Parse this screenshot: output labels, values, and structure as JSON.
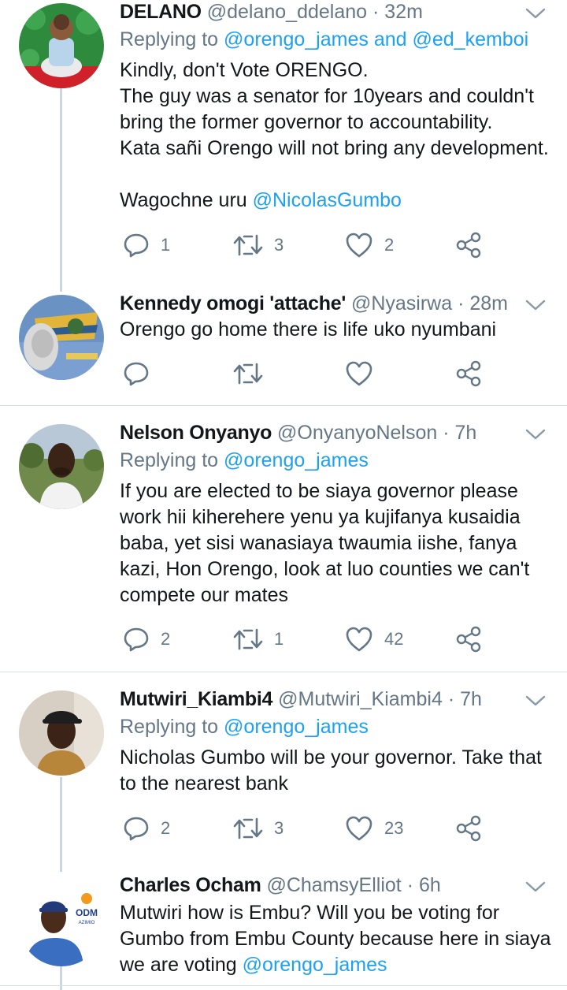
{
  "tweets": [
    {
      "name": "DELANO",
      "handle": "@delano_ddelano",
      "dot": "·",
      "time": "32m",
      "replying_prefix": "Replying to",
      "replying_1": "@orengo_james",
      "replying_and": "and",
      "replying_2": "@ed_kemboi",
      "lines": [
        "Kindly, don't Vote ORENGO.",
        "The guy was a senator for 10years and couldn't",
        "bring the former governor to accountability.",
        "Kata sañi Orengo will not bring any development."
      ],
      "last_line_text": "Wagochne uru",
      "last_line_link": "@NicolasGumbo",
      "replies": "1",
      "retweets": "3",
      "likes": "2"
    },
    {
      "name": "Kennedy omogi 'attache'",
      "handle": "@Nyasirwa",
      "dot": "·",
      "time": "28m",
      "lines": [
        "Orengo go home there is life uko nyumbani"
      ],
      "replies": "",
      "retweets": "",
      "likes": ""
    },
    {
      "name": "Nelson Onyanyo",
      "handle": "@OnyanyoNelson",
      "dot": "·",
      "time": "7h",
      "replying_prefix": "Replying to",
      "replying_1": "@orengo_james",
      "lines": [
        "If you are elected to be siaya governor please",
        "work hii kiherehere yenu ya kujifanya kusaidia",
        "baba, yet sisi wanasiaya twaumia iishe, fanya",
        "kazi, Hon Orengo, look at luo counties we can't",
        "compete our mates"
      ],
      "replies": "2",
      "retweets": "1",
      "likes": "42"
    },
    {
      "name": "Mutwiri_Kiambi4",
      "handle": "@Mutwiri_Kiambi4",
      "dot": "·",
      "time": "7h",
      "replying_prefix": "Replying to",
      "replying_1": "@orengo_james",
      "lines": [
        "Nicholas Gumbo will be your governor. Take that",
        "to the nearest bank"
      ],
      "replies": "2",
      "retweets": "3",
      "likes": "23"
    },
    {
      "name": "Charles Ocham",
      "handle": "@ChamsyElliot",
      "dot": "·",
      "time": "6h",
      "lines": [
        "Mutwiri how is Embu? Will you be voting for",
        "Gumbo from Embu County because here in siaya"
      ],
      "last_line_text": "we are voting",
      "last_line_link": "@orengo_james",
      "avatar_badge": "ODM",
      "avatar_badge_sub": "AZIMIO"
    }
  ],
  "icons": {
    "reply": "reply-icon",
    "retweet": "retweet-icon",
    "like": "heart-icon",
    "share": "share-icon",
    "more": "chevron-down-icon"
  },
  "colors": {
    "link": "#1da1f2",
    "secondary": "#657786",
    "icon": "#657786",
    "thread_line": "#ccd6dd",
    "separator": "#d6dde3"
  }
}
